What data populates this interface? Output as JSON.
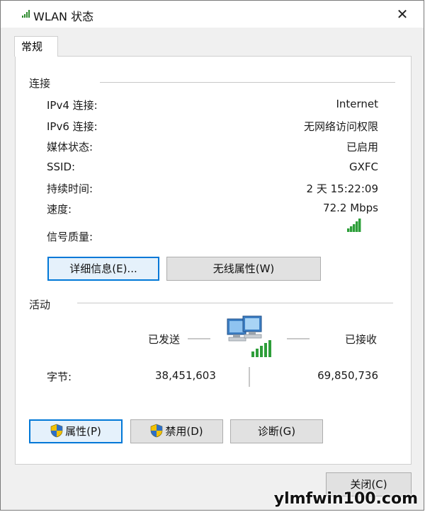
{
  "window": {
    "title": "WLAN 状态",
    "close_glyph": "✕"
  },
  "tab": {
    "label": "常规"
  },
  "connection": {
    "heading": "连接",
    "rows": [
      {
        "label": "IPv4 连接:",
        "value": "Internet"
      },
      {
        "label": "IPv6 连接:",
        "value": "无网络访问权限"
      },
      {
        "label": "媒体状态:",
        "value": "已启用"
      },
      {
        "label": "SSID:",
        "value": "GXFC"
      },
      {
        "label": "持续时间:",
        "value": "2 天 15:22:09"
      },
      {
        "label": "速度:",
        "value": "72.2 Mbps"
      }
    ],
    "signal_label": "信号质量:",
    "signal_icon": "signal-strength-icon",
    "details_button": "详细信息(E)...",
    "wireless_props_button": "无线属性(W)"
  },
  "activity": {
    "heading": "活动",
    "sent_label": "已发送",
    "received_label": "已接收",
    "bytes_label": "字节:",
    "bytes_sent": "38,451,603",
    "bytes_received": "69,850,736",
    "network_icon": "network-computers-icon"
  },
  "buttons": {
    "properties": "属性(P)",
    "disable": "禁用(D)",
    "diagnose": "诊断(G)",
    "close": "关闭(C)"
  },
  "watermark": "ylmfwin100.com",
  "colors": {
    "accent": "#0078d7",
    "signal": "#2e9e3a"
  }
}
